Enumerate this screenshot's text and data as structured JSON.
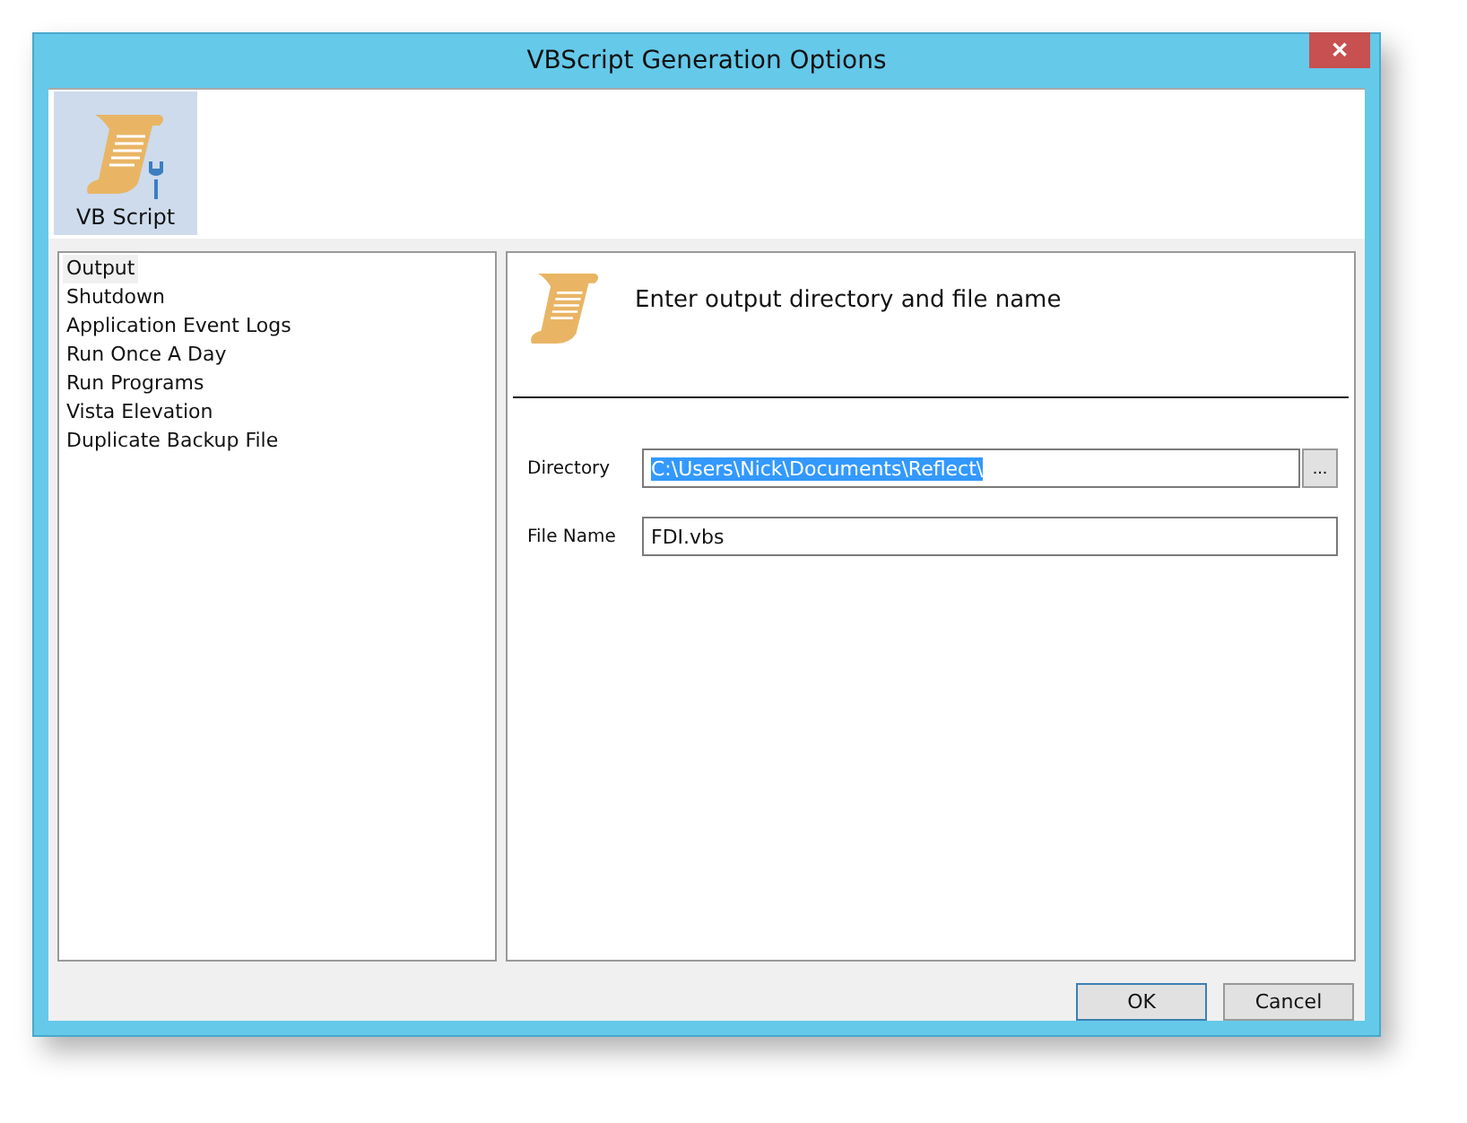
{
  "window": {
    "title": "VBScript Generation Options",
    "close": "✕"
  },
  "toolbar": [
    {
      "label": "VB Script",
      "selected": true
    }
  ],
  "sidebar": {
    "items": [
      {
        "label": "Output",
        "selected": true
      },
      {
        "label": "Shutdown",
        "selected": false
      },
      {
        "label": "Application Event Logs",
        "selected": false
      },
      {
        "label": "Run Once A Day",
        "selected": false
      },
      {
        "label": "Run Programs",
        "selected": false
      },
      {
        "label": "Vista Elevation",
        "selected": false
      },
      {
        "label": "Duplicate Backup File",
        "selected": false
      }
    ]
  },
  "panel": {
    "heading": "Enter output directory and file name",
    "fields": [
      {
        "label": "Directory",
        "value": "C:\\Users\\Nick\\Documents\\Reflect\\",
        "highlighted": true,
        "browse": "..."
      },
      {
        "label": "File Name",
        "value": "FDI.vbs",
        "highlighted": false
      }
    ]
  },
  "buttons": [
    {
      "label": "OK",
      "default": true
    },
    {
      "label": "Cancel",
      "default": false
    }
  ]
}
